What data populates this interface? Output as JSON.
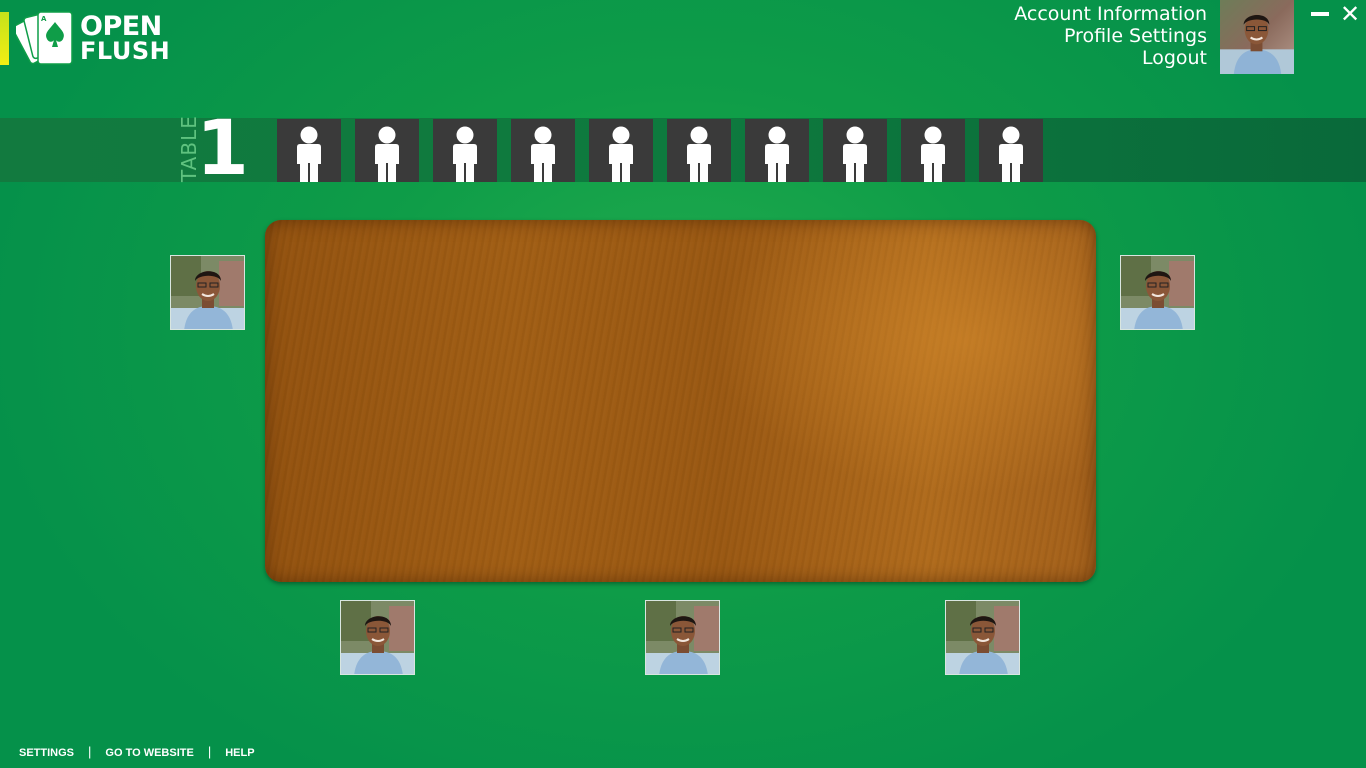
{
  "app": {
    "logo_line1": "OPEN",
    "logo_line2": "FLUSH",
    "accent_color": "#0f9d48"
  },
  "account_menu": {
    "items": [
      "Account Information",
      "Profile Settings",
      "Logout"
    ]
  },
  "window_controls": {
    "minimize": "minimize-icon",
    "close_label": "✕"
  },
  "table": {
    "word": "TABLE",
    "number": "1",
    "seat_count": 10,
    "seat_icon": "person-icon"
  },
  "players": {
    "icon": "player-avatar-photo"
  },
  "footer": {
    "settings": "SETTINGS",
    "website": "GO TO WEBSITE",
    "help": "HELP",
    "separator": "|"
  }
}
